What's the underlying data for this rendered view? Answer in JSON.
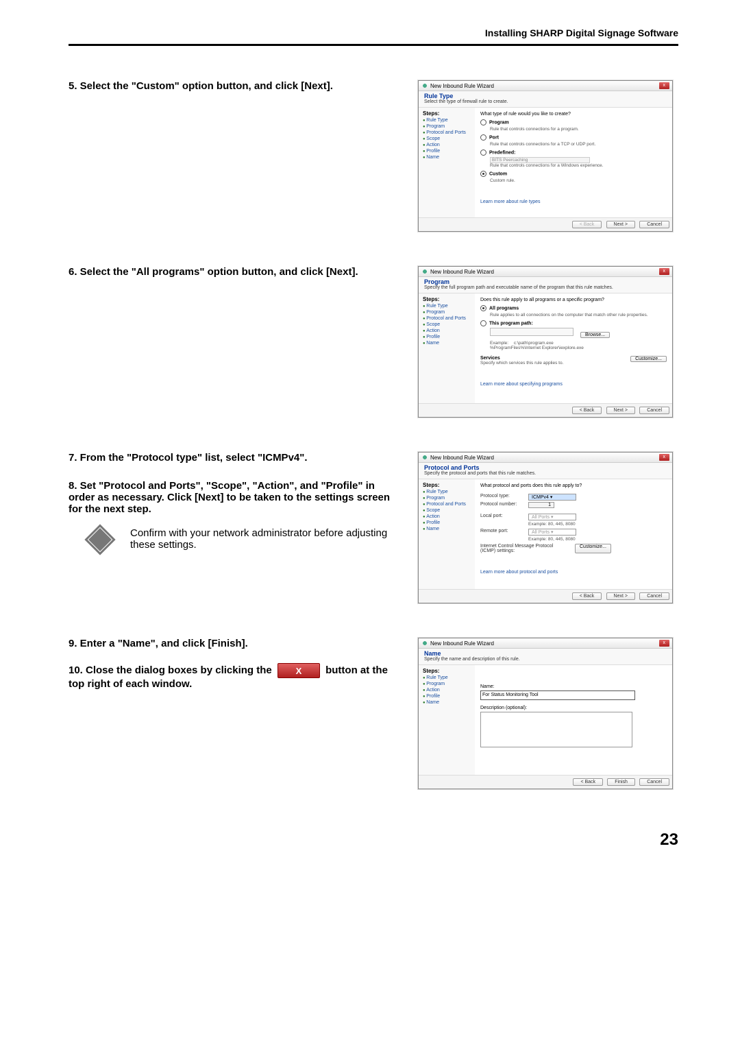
{
  "header": "Installing SHARP Digital Signage Software",
  "steps": {
    "s5": "5.  Select the \"Custom\" option button, and click [Next].",
    "s6": "6.  Select the \"All programs\" option button, and click [Next].",
    "s7": "7.  From the \"Protocol type\" list, select \"ICMPv4\".",
    "s8": "8.  Set \"Protocol and Ports\", \"Scope\", \"Action\", and \"Profile\" in order as necessary. Click [Next] to be taken to the settings screen for the next step.",
    "s8_note": "Confirm with your network administrator before adjusting these settings.",
    "s9": "9.  Enter a \"Name\", and click [Finish].",
    "s10a": "10. Close the dialog boxes by clicking the",
    "s10b": "button at the top right of each window."
  },
  "close_x": "X",
  "wizard_common": {
    "title": "New Inbound Rule Wizard",
    "steps_header": "Steps:",
    "step_items": [
      "Rule Type",
      "Program",
      "Protocol and Ports",
      "Scope",
      "Action",
      "Profile",
      "Name"
    ],
    "btn_back": "< Back",
    "btn_next": "Next >",
    "btn_finish": "Finish",
    "btn_cancel": "Cancel"
  },
  "wiz1": {
    "head_title": "Rule Type",
    "head_sub": "Select the type of firewall rule to create.",
    "q": "What type of rule would you like to create?",
    "opts": {
      "program": "Program",
      "program_sub": "Rule that controls connections for a program.",
      "port": "Port",
      "port_sub": "Rule that controls connections for a TCP or UDP port.",
      "pre": "Predefined:",
      "pre_val": "BITS Peercaching",
      "pre_sub": "Rule that controls connections for a Windows experience.",
      "custom": "Custom",
      "custom_sub": "Custom rule."
    },
    "learn": "Learn more about rule types"
  },
  "wiz2": {
    "head_title": "Program",
    "head_sub": "Specify the full program path and executable name of the program that this rule matches.",
    "q": "Does this rule apply to all programs or a specific program?",
    "all": "All programs",
    "all_sub": "Rule applies to all connections on the computer that match other rule properties.",
    "path": "This program path:",
    "browse": "Browse...",
    "example_lbl": "Example:",
    "example_val": "c:\\path\\program.exe\n%ProgramFiles%\\Internet Explorer\\iexplore.exe",
    "services": "Services",
    "services_sub": "Specify which services this rule applies to.",
    "customize": "Customize...",
    "learn": "Learn more about specifying programs"
  },
  "wiz3": {
    "head_title": "Protocol and Ports",
    "head_sub": "Specify the protocol and ports that this rule matches.",
    "q": "What protocol and ports does this rule apply to?",
    "proto_type": "Protocol type:",
    "proto_val": "ICMPv4",
    "proto_num": "Protocol number:",
    "proto_num_val": "1",
    "local_port": "Local port:",
    "local_port_val": "All Ports",
    "ex1": "Example: 80, 445, 8080",
    "remote_port": "Remote port:",
    "remote_port_val": "All Ports",
    "ex2": "Example: 80, 445, 8080",
    "icmp_lbl": "Internet Control Message Protocol (ICMP) settings:",
    "customize": "Customize...",
    "learn": "Learn more about protocol and ports"
  },
  "wiz4": {
    "head_title": "Name",
    "head_sub": "Specify the name and description of this rule.",
    "step_items_full": [
      "Rule Type",
      "Program",
      "Action",
      "Profile",
      "Name"
    ],
    "name_lbl": "Name:",
    "name_val": "For Status Monitoring Tool",
    "desc_lbl": "Description (optional):"
  },
  "page_number": "23"
}
